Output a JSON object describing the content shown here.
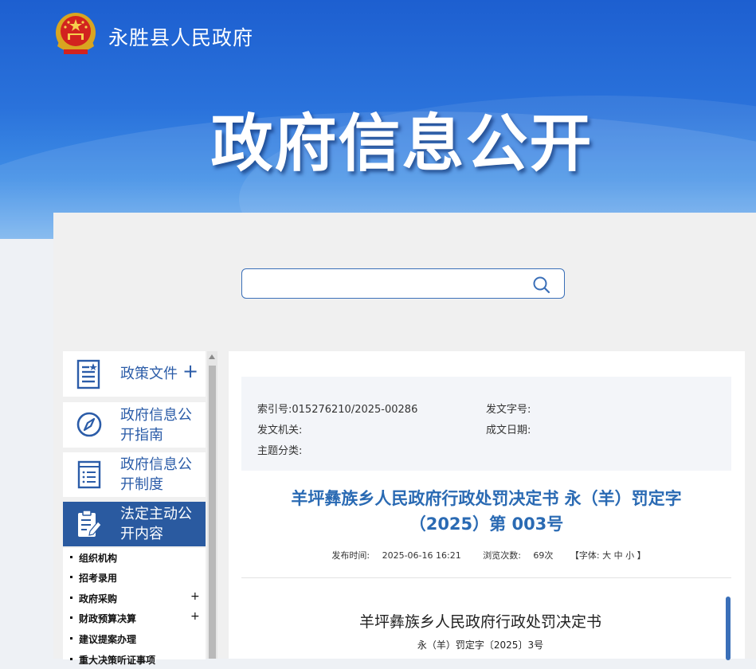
{
  "site": {
    "name": "永胜县人民政府",
    "banner_title": "政府信息公开"
  },
  "search": {
    "placeholder": "",
    "value": ""
  },
  "sidebar": {
    "items": [
      {
        "label": "政策文件",
        "has_plus": true,
        "plus": "+"
      },
      {
        "label": "政府信息公开指南"
      },
      {
        "label": "政府信息公开制度"
      },
      {
        "label": "法定主动公开内容",
        "active": true
      }
    ],
    "subitems": [
      {
        "label": "组织机构"
      },
      {
        "label": "招考录用"
      },
      {
        "label": "政府采购",
        "plus": "+"
      },
      {
        "label": "财政预算决算",
        "plus": "+"
      },
      {
        "label": "建议提案办理"
      },
      {
        "label": "重大决策听证事项"
      }
    ]
  },
  "meta": {
    "index_label": "索引号:",
    "index_value": "015276210/2025-00286",
    "doc_no_label": "发文字号:",
    "doc_no_value": "",
    "issuer_label": "发文机关:",
    "issuer_value": "",
    "date_label": "成文日期:",
    "date_value": "",
    "topic_label": "主题分类:",
    "topic_value": ""
  },
  "document": {
    "title_line1": "羊坪彝族乡人民政府行政处罚决定书 永（羊）罚定字",
    "title_line2": "（2025）第 003号",
    "publish_label": "发布时间:",
    "publish_time": "2025-06-16 16:21",
    "views_label": "浏览次数:",
    "views": "69次",
    "font_size_control": "【字体: 大 中 小 】",
    "body_title": "羊坪彝族乡人民政府行政处罚决定书",
    "body_subtitle": "永（羊）罚定字〔2025〕3号"
  },
  "colors": {
    "accent": "#2a5aa0",
    "title_blue": "#2a6ab3",
    "banner_blue": "#1d5fd0"
  }
}
